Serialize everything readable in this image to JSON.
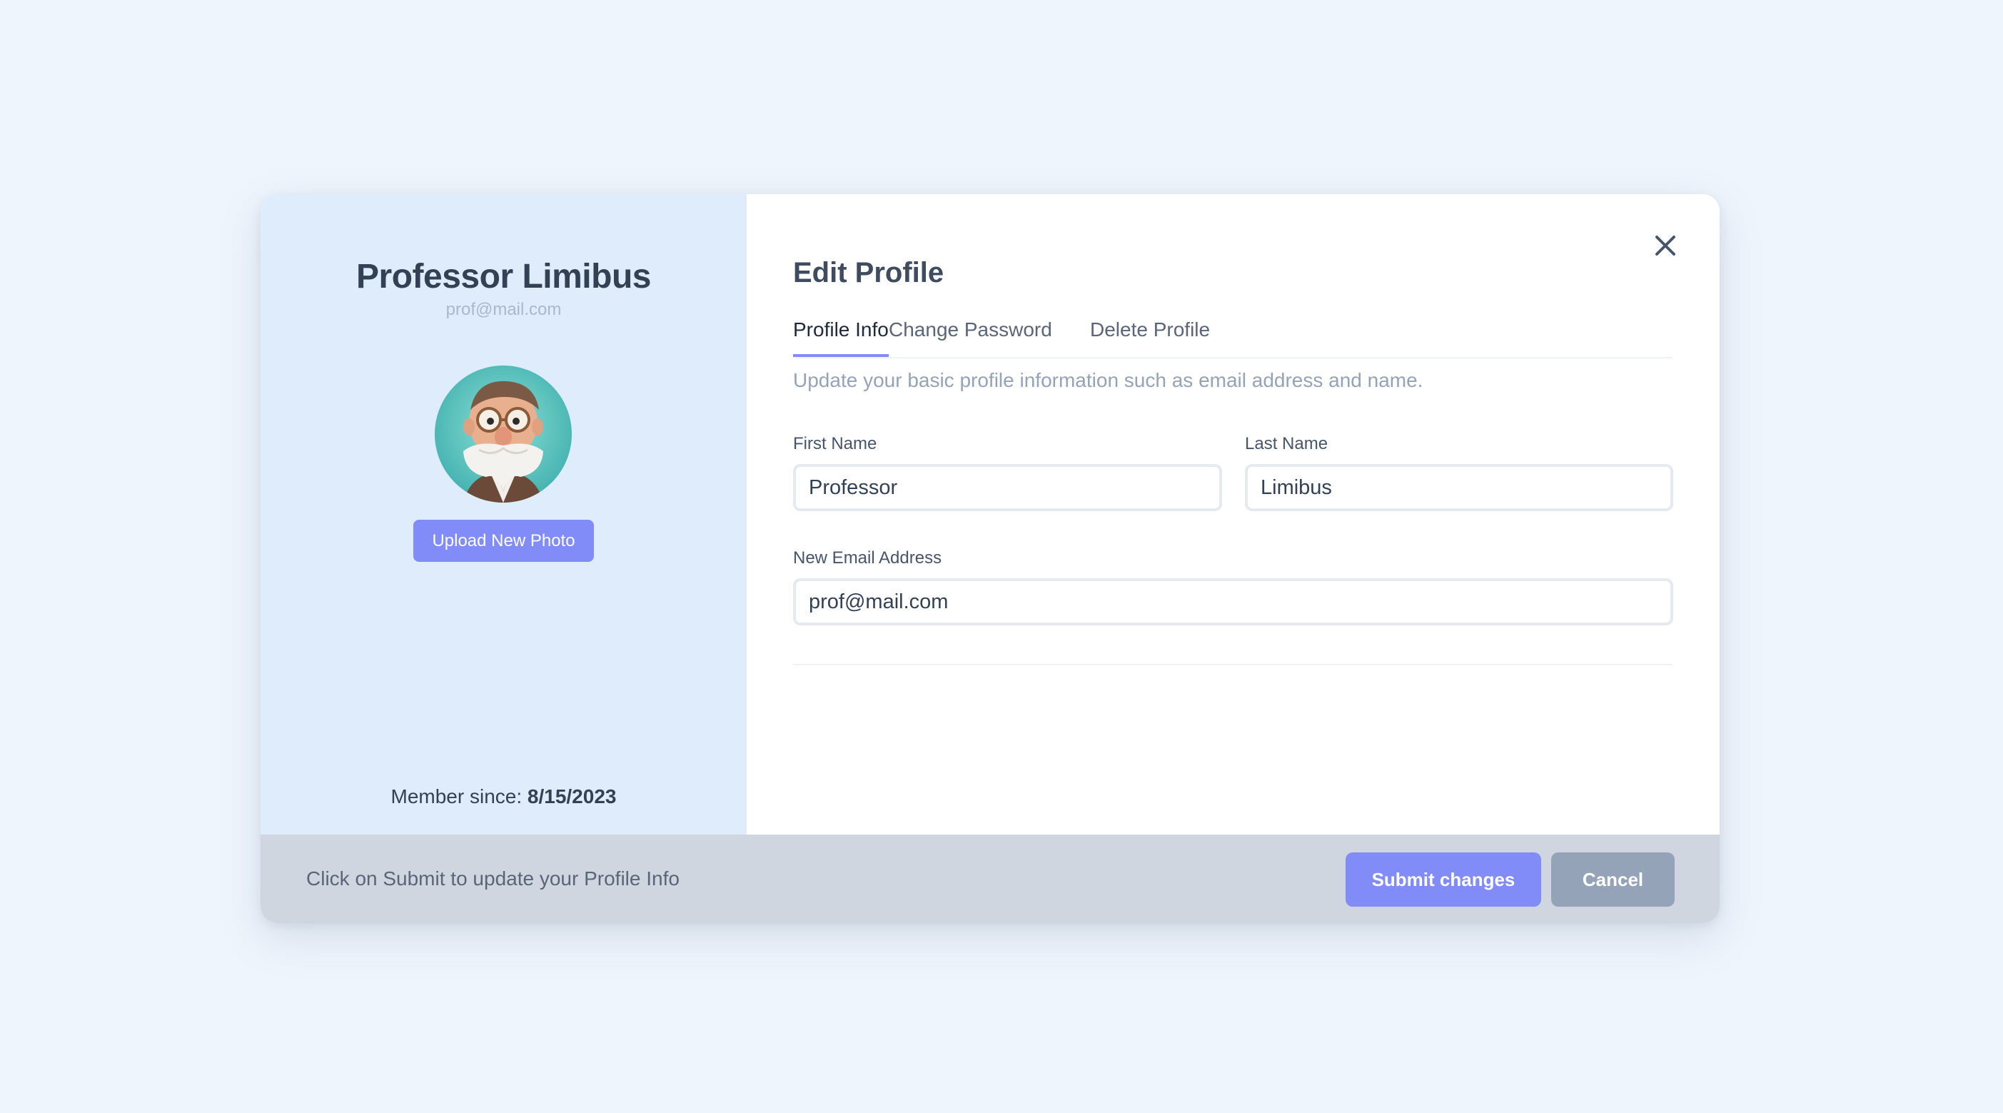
{
  "sidebar": {
    "name": "Professor Limibus",
    "email": "prof@mail.com",
    "avatar_icon": "professor-avatar",
    "upload_label": "Upload New Photo",
    "member_since_label": "Member since:",
    "member_since_date": "8/15/2023"
  },
  "header": {
    "title": "Edit Profile",
    "close_icon": "close-icon"
  },
  "tabs": [
    {
      "label": "Profile Info",
      "active": true
    },
    {
      "label": "Change Password",
      "active": false
    },
    {
      "label": "Delete Profile",
      "active": false
    }
  ],
  "form": {
    "description": "Update your basic profile information such as email address and name.",
    "first_name": {
      "label": "First Name",
      "value": "Professor"
    },
    "last_name": {
      "label": "Last Name",
      "value": "Limibus"
    },
    "email": {
      "label": "New Email Address",
      "value": "prof@mail.com"
    }
  },
  "footer": {
    "hint": "Click on Submit to update your Profile Info",
    "submit_label": "Submit changes",
    "cancel_label": "Cancel"
  },
  "colors": {
    "accent": "#818cf8",
    "sidebar_bg": "#deecfc",
    "footer_bg": "#cfd6e0",
    "cancel_bg": "#94a3b8",
    "page_bg": "#eef5fd"
  }
}
